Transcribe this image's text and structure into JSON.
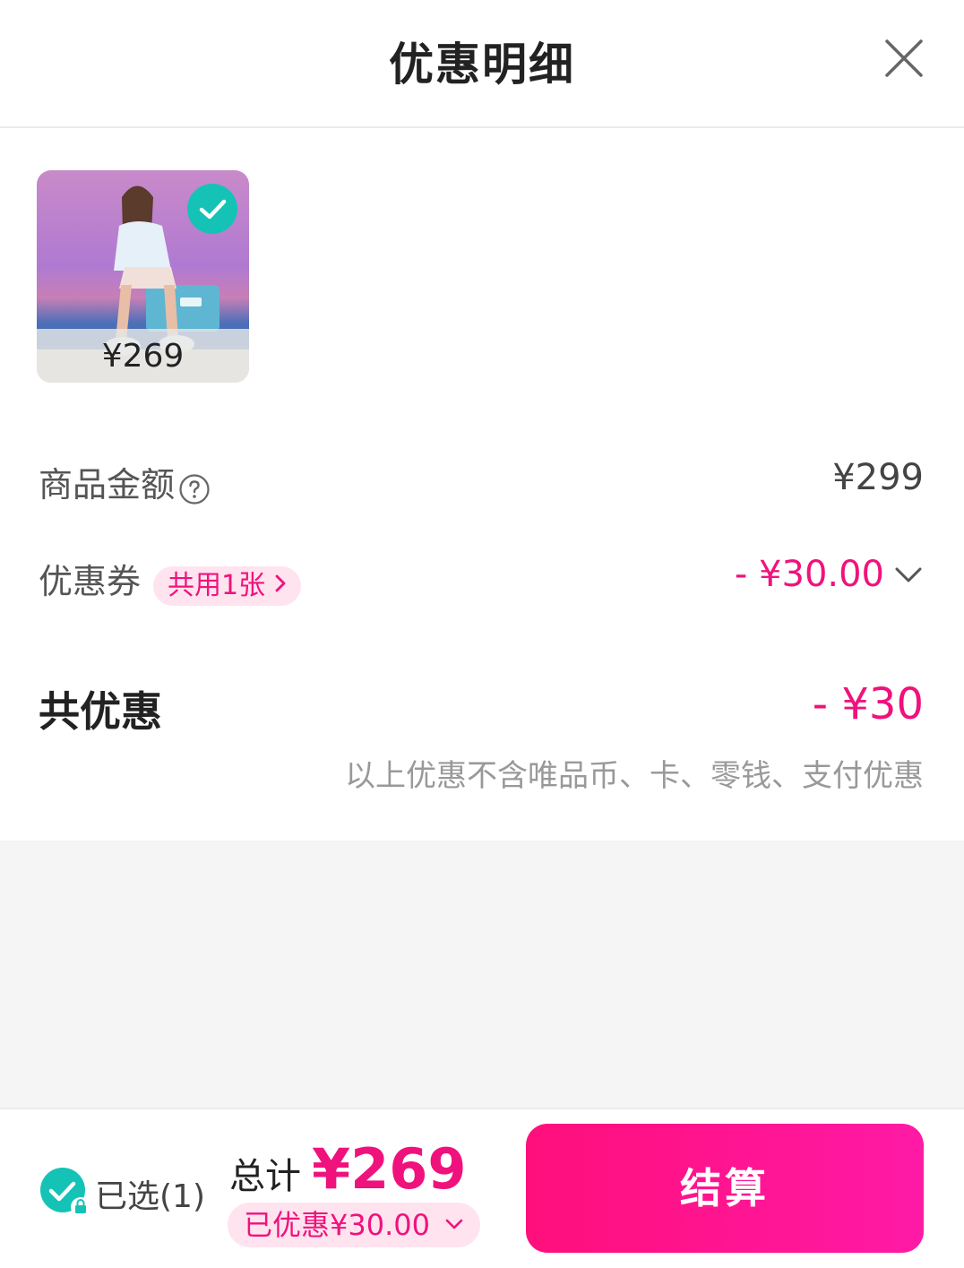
{
  "header": {
    "title": "优惠明细",
    "close_icon": "close-icon"
  },
  "product": {
    "price": "¥269",
    "selected": true,
    "check_icon": "check-icon"
  },
  "rows": {
    "goods_amount": {
      "label": "商品金额",
      "value": "¥299",
      "help_icon": "question-circle-icon"
    },
    "coupon": {
      "label": "优惠券",
      "chip": "共用1张",
      "value": "- ¥30.00",
      "chevron_icon": "chevron-down-icon"
    }
  },
  "total_discount": {
    "label": "共优惠",
    "value": "- ¥30",
    "note": "以上优惠不含唯品币、卡、零钱、支付优惠"
  },
  "footer": {
    "selected_label": "已选(1)",
    "total_word": "总计",
    "total_amount": "¥269",
    "discount_pill": "已优惠¥30.00",
    "checkout_label": "结算"
  },
  "colors": {
    "accent": "#f0127c",
    "teal": "#14c3b6",
    "chip_bg": "#ffe3ef"
  }
}
